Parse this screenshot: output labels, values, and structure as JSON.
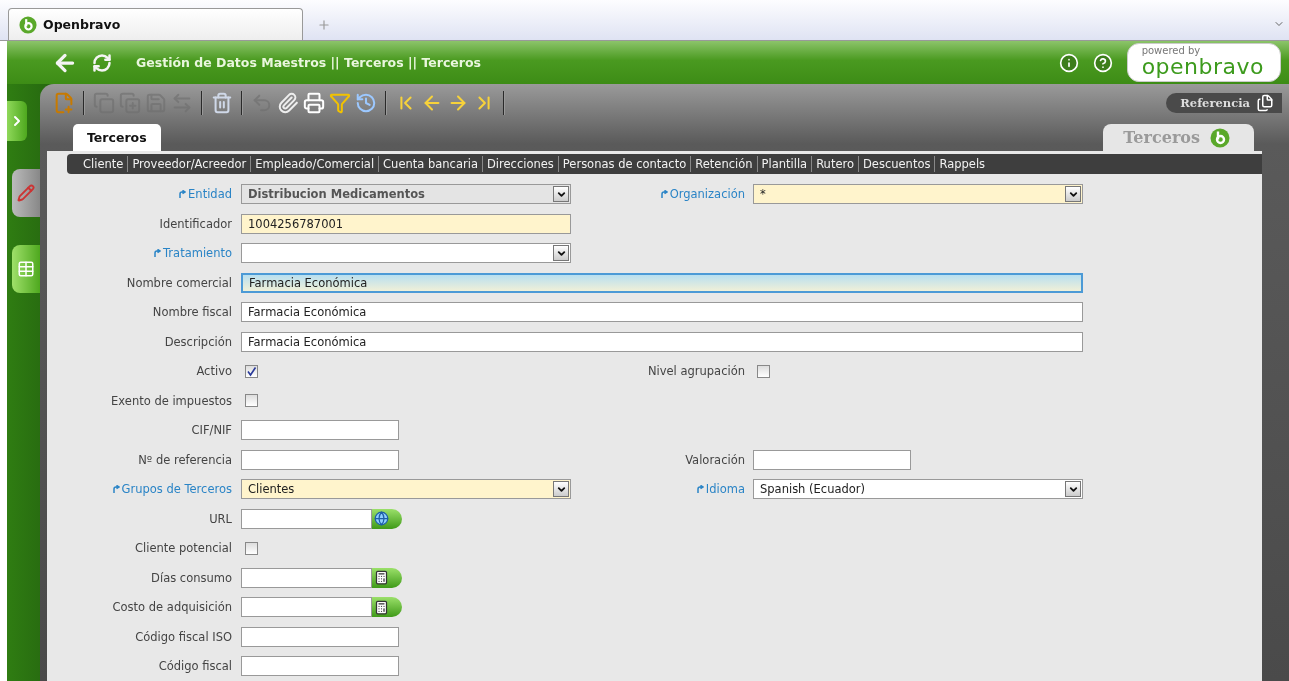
{
  "browser_tab": {
    "title": "Openbravo"
  },
  "header": {
    "breadcrumb": "Gestión de Datos Maestros || Terceros || Terceros",
    "logo_caption": "powered by",
    "logo_name": "openbravo"
  },
  "sidebar": {
    "views": [
      {
        "selected": true
      },
      {
        "selected": false
      }
    ]
  },
  "toolbar": [
    {
      "disabled": false
    },
    {
      "disabled": true
    },
    {
      "disabled": true
    },
    {
      "disabled": true
    },
    {
      "disabled": true
    },
    {
      "disabled": false
    },
    {
      "disabled": true
    },
    {
      "disabled": false
    },
    {
      "disabled": false
    },
    {
      "disabled": false
    },
    {
      "disabled": false
    },
    {
      "disabled": false
    },
    {
      "disabled": false
    },
    {
      "disabled": false
    },
    {
      "disabled": false
    }
  ],
  "reference_button": {
    "label": "Referencia"
  },
  "tabs": [
    {
      "label": "Terceros",
      "selected": true
    }
  ],
  "window_label": "Terceros",
  "subtabs": [
    "Cliente",
    "Proveedor/Acreedor",
    "Empleado/Comercial",
    "Cuenta bancaria",
    "Direcciones",
    "Personas de contacto",
    "Retención",
    "Plantilla",
    "Rutero",
    "Descuentos",
    "Rappels"
  ],
  "rows": [
    {
      "left": {
        "label": "Entidad",
        "link": true,
        "kind": "select",
        "readonly": true,
        "required": false,
        "focused": false,
        "value": "Distribucion Medicamentos"
      },
      "right": {
        "label": "Organización",
        "link": true,
        "kind": "select",
        "readonly": false,
        "required": true,
        "focused": false,
        "value": "*"
      }
    },
    {
      "left": {
        "label": "Identificador",
        "link": false,
        "kind": "longtext",
        "readonly": false,
        "required": true,
        "focused": false,
        "value": "1004256787001"
      }
    },
    {
      "left": {
        "label": "Tratamiento",
        "link": true,
        "kind": "select",
        "readonly": false,
        "required": false,
        "focused": false
      }
    },
    {
      "left": {
        "label": "Nombre comercial",
        "link": false,
        "kind": "widetext",
        "readonly": false,
        "required": false,
        "focused": true,
        "value": "Farmacia Económica"
      }
    },
    {
      "left": {
        "label": "Nombre fiscal",
        "link": false,
        "kind": "widetext",
        "readonly": false,
        "required": false,
        "focused": false,
        "value": "Farmacia Económica"
      }
    },
    {
      "left": {
        "label": "Descripción",
        "link": false,
        "kind": "widetext",
        "readonly": false,
        "required": false,
        "focused": false,
        "value": "Farmacia Económica"
      }
    },
    {
      "left": {
        "label": "Activo",
        "link": false,
        "kind": "checkbox",
        "checked": true
      },
      "right": {
        "label": "Nivel agrupación",
        "link": false,
        "kind": "checkbox",
        "checked": false
      }
    },
    {
      "left": {
        "label": "Exento de impuestos",
        "link": false,
        "kind": "checkbox",
        "checked": false
      }
    },
    {
      "left": {
        "label": "CIF/NIF",
        "link": false,
        "kind": "text",
        "readonly": false,
        "required": false,
        "focused": false
      }
    },
    {
      "left": {
        "label": "Nº de referencia",
        "link": false,
        "kind": "text",
        "readonly": false,
        "required": false,
        "focused": false
      },
      "right": {
        "label": "Valoración",
        "link": false,
        "kind": "text",
        "readonly": false,
        "required": false,
        "focused": false
      }
    },
    {
      "left": {
        "label": "Grupos de Terceros",
        "link": true,
        "kind": "select",
        "readonly": false,
        "required": true,
        "focused": false,
        "value": "Clientes"
      },
      "right": {
        "label": "Idioma",
        "link": true,
        "kind": "select",
        "readonly": false,
        "required": false,
        "focused": false,
        "value": "Spanish (Ecuador)"
      }
    },
    {
      "left": {
        "label": "URL",
        "link": false,
        "kind": "url",
        "readonly": false,
        "required": false,
        "focused": false
      }
    },
    {
      "left": {
        "label": "Cliente potencial",
        "link": false,
        "kind": "checkbox",
        "checked": false
      }
    },
    {
      "left": {
        "label": "Días consumo",
        "link": false,
        "kind": "number",
        "readonly": false,
        "required": false,
        "focused": false
      }
    },
    {
      "left": {
        "label": "Costo de adquisición",
        "link": false,
        "kind": "number",
        "readonly": false,
        "required": false,
        "focused": false
      }
    },
    {
      "left": {
        "label": "Código fiscal ISO",
        "link": false,
        "kind": "text",
        "readonly": false,
        "required": false,
        "focused": false
      }
    },
    {
      "left": {
        "label": "Código fiscal",
        "link": false,
        "kind": "text",
        "readonly": false,
        "required": false,
        "focused": false
      }
    }
  ]
}
